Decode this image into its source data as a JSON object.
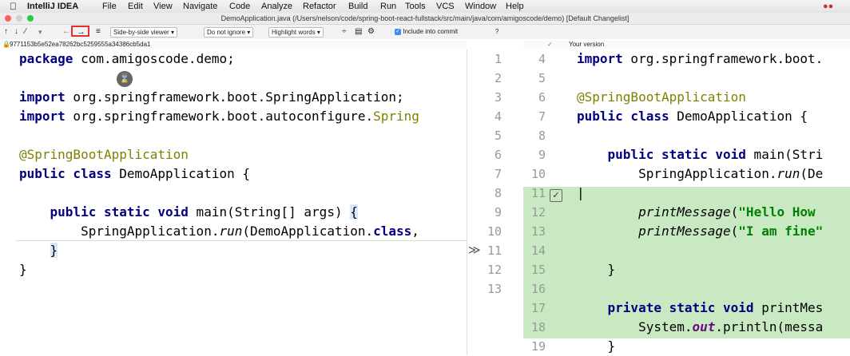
{
  "menubar": {
    "app": "IntelliJ IDEA",
    "items": [
      "File",
      "Edit",
      "View",
      "Navigate",
      "Code",
      "Analyze",
      "Refactor",
      "Build",
      "Run",
      "Tools",
      "VCS",
      "Window",
      "Help"
    ]
  },
  "titlebar": {
    "title": "DemoApplication.java (/Users/nelson/code/spring-boot-react-fullstack/src/main/java/com/amigoscode/demo) [Default Changelist]"
  },
  "toolbar": {
    "viewer": "Side-by-side viewer",
    "ignore": "Do not ignore",
    "highlight": "Highlight words",
    "include": "Include into commit",
    "help": "?"
  },
  "left": {
    "hash": "9771153b5e52ea78262bc5259555a34386cb5da1",
    "lines": [
      "package com.amigoscode.demo;",
      "",
      "import org.springframework.boot.SpringApplication;",
      "import org.springframework.boot.autoconfigure.Spring",
      "",
      "@SpringBootApplication",
      "public class DemoApplication {",
      "",
      "    public static void main(String[] args) {",
      "        SpringApplication.run(DemoApplication.class,",
      "    }",
      "}"
    ]
  },
  "right": {
    "header": "Your version",
    "left_numbers": [
      "1",
      "2",
      "3",
      "4",
      "5",
      "6",
      "7",
      "8",
      "9",
      "10",
      "11",
      "12",
      "13"
    ],
    "right_numbers": [
      "4",
      "5",
      "6",
      "7",
      "8",
      "9",
      "10",
      "11",
      "12",
      "13",
      "14",
      "15",
      "16",
      "17",
      "18",
      "19"
    ],
    "marker": "≫",
    "lines": [
      "import org.springframework.boot.",
      "",
      "@SpringBootApplication",
      "public class DemoApplication {",
      "",
      "    public static void main(Stri",
      "        SpringApplication.run(De",
      "",
      "        printMessage(\"Hello How ",
      "        printMessage(\"I am fine\"",
      "",
      "    }",
      "",
      "    private static void printMes",
      "        System.out.println(messa",
      "    }"
    ]
  }
}
